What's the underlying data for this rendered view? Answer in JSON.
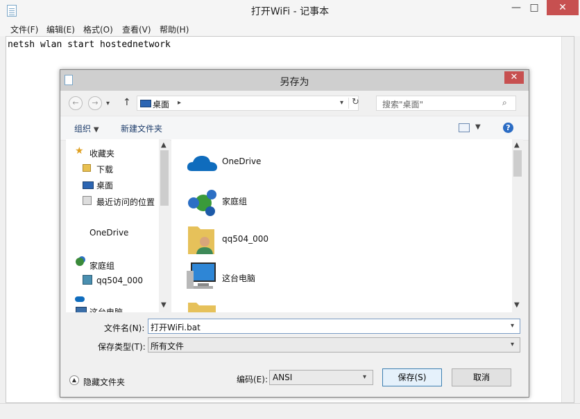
{
  "notepad": {
    "title": "打开WiFi - 记事本",
    "menu": [
      "文件(F)",
      "编辑(E)",
      "格式(O)",
      "查看(V)",
      "帮助(H)"
    ],
    "text": "netsh wlan start hostednetwork",
    "controls": {
      "minimize": "—",
      "maximize": "□",
      "close": "✕"
    }
  },
  "dialog": {
    "title": "另存为",
    "close": "✕",
    "address": {
      "location": "桌面"
    },
    "search_placeholder": "搜索\"桌面\"",
    "toolbar": {
      "organize": "组织",
      "new_folder": "新建文件夹"
    },
    "nav_items": [
      {
        "label": "收藏夹",
        "icon": "star-icon"
      },
      {
        "label": "下载",
        "icon": "download-folder-icon"
      },
      {
        "label": "桌面",
        "icon": "desktop-icon"
      },
      {
        "label": "最近访问的位置",
        "icon": "recent-places-icon"
      },
      {
        "label": "OneDrive",
        "icon": "onedrive-icon"
      },
      {
        "label": "家庭组",
        "icon": "homegroup-icon"
      },
      {
        "label": "qq504_000",
        "icon": "user-icon"
      },
      {
        "label": "这台电脑",
        "icon": "computer-icon"
      }
    ],
    "content_items": [
      {
        "label": "OneDrive",
        "icon": "onedrive-cloud-icon"
      },
      {
        "label": "家庭组",
        "icon": "homegroup-icon"
      },
      {
        "label": "qq504_000",
        "icon": "user-folder-icon"
      },
      {
        "label": "这台电脑",
        "icon": "computer-icon"
      },
      {
        "label": "",
        "icon": "folder-icon"
      }
    ],
    "filename_label": "文件名(N):",
    "filename_value": "打开WiFi.bat",
    "filetype_label": "保存类型(T):",
    "filetype_value": "所有文件",
    "encoding_label": "编码(E):",
    "encoding_value": "ANSI",
    "save_button": "保存(S)",
    "cancel_button": "取消",
    "hide_folders": "隐藏文件夹"
  },
  "colors": {
    "accent": "#1e6fbf",
    "close_red": "#c75050",
    "onedrive_blue": "#0f6cbd"
  }
}
